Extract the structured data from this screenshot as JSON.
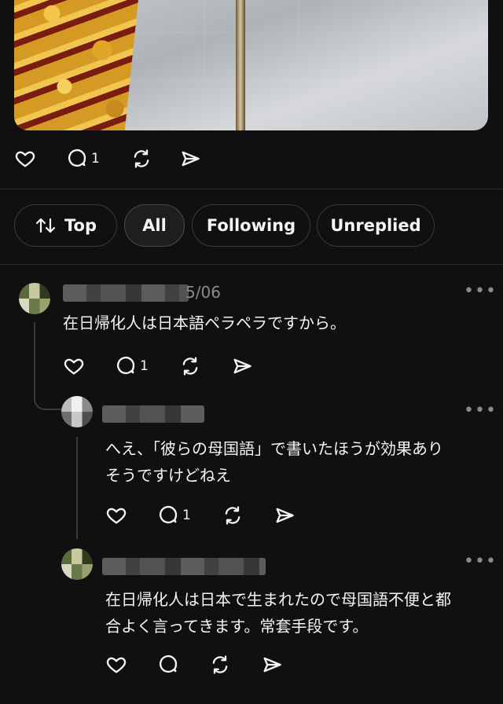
{
  "post": {
    "actions": {
      "like_count": "",
      "reply_count": "1",
      "repost_count": "",
      "share_count": ""
    }
  },
  "filters": {
    "top_label": "Top",
    "all_label": "All",
    "following_label": "Following",
    "unreplied_label": "Unreplied",
    "active": "All"
  },
  "comments": [
    {
      "date": "5/06",
      "text": "在日帰化人は日本語ペラペラですから。",
      "reply_count": "1"
    },
    {
      "text_line1": "へえ、「彼らの母国語」で書いたほうが効果あり",
      "text_line2": "そうですけどねえ",
      "reply_count": "1"
    },
    {
      "text_line1": "在日帰化人は日本で生まれたので母国語不便と都",
      "text_line2": "合よく言ってきます。常套手段です。",
      "reply_count": ""
    }
  ],
  "more_label": "•••"
}
